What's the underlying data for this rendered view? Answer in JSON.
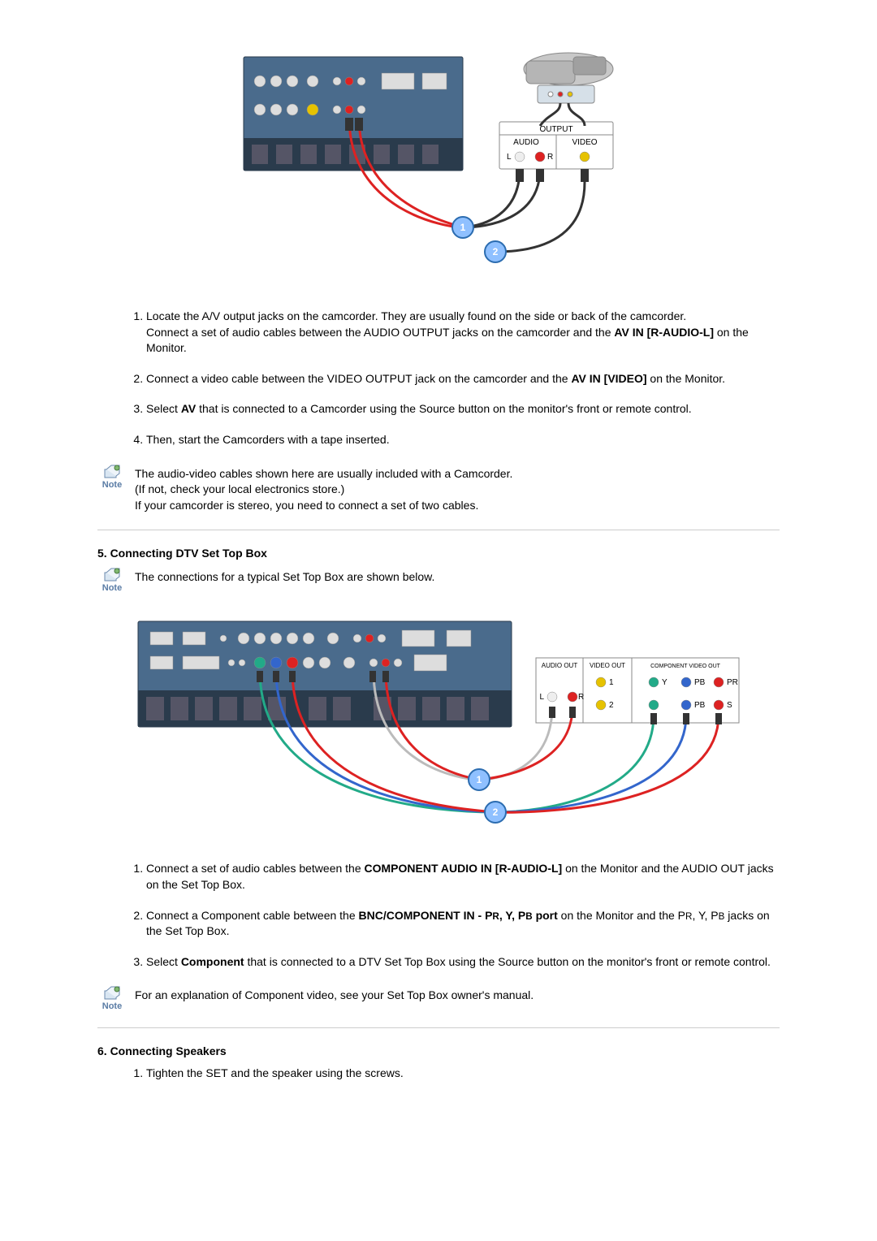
{
  "note_label": "Note",
  "section4": {
    "diagram": {
      "output_label": "OUTPUT",
      "audio_label": "AUDIO",
      "video_label": "VIDEO",
      "l_label": "L",
      "r_label": "R",
      "callout1": "1",
      "callout2": "2"
    },
    "steps": [
      {
        "p1_pre": "Locate the A/V output jacks on the camcorder. They are usually found on the side or back of the camcorder.",
        "p2_a": "Connect a set of audio cables between the AUDIO OUTPUT jacks on the camcorder and the ",
        "p2_bold": "AV IN [R-AUDIO-L]",
        "p2_b": " on the Monitor."
      },
      {
        "a": "Connect a video cable between the VIDEO OUTPUT jack on the camcorder and the ",
        "bold": "AV IN [VIDEO]",
        "b": " on the Monitor."
      },
      {
        "a": "Select ",
        "bold": "AV",
        "b": " that is connected to a Camcorder using the Source button on the monitor's front or remote control."
      },
      {
        "text": "Then, start the Camcorders with a tape inserted."
      }
    ],
    "note": {
      "line1": "The audio-video cables shown here are usually included with a Camcorder.",
      "line2": "(If not, check your local electronics store.)",
      "line3": "If your camcorder is stereo, you need to connect a set of two cables."
    }
  },
  "section5": {
    "heading": "5. Connecting DTV Set Top Box",
    "intro_note": "The connections for a typical Set Top Box are shown below.",
    "diagram": {
      "audio_out": "AUDIO OUT",
      "video_out": "VIDEO OUT",
      "component_out": "COMPONENT VIDEO OUT",
      "l": "L",
      "r": "R",
      "one": "1",
      "two": "2",
      "y": "Y",
      "pb": "PB",
      "pr": "PR",
      "s": "S",
      "callout1": "1",
      "callout2": "2"
    },
    "steps": [
      {
        "a": "Connect a set of audio cables between the ",
        "bold": "COMPONENT AUDIO IN [R-AUDIO-L]",
        "b": " on the Monitor and the AUDIO OUT jacks on the Set Top Box."
      },
      {
        "a": "Connect a Component cable between the ",
        "bold_a": "BNC/COMPONENT IN - P",
        "bold_r": "R",
        "bold_b": ", Y, P",
        "bold_b2": "B",
        "bold_c": " port",
        "b_a": " on the Monitor and the P",
        "b_r": "R",
        "b_b": ", Y, P",
        "b_b2": "B",
        "b_c": " jacks on the Set Top Box."
      },
      {
        "a": "Select ",
        "bold": "Component",
        "b": " that is connected to a DTV Set Top Box using the Source button on the monitor's front or remote control."
      }
    ],
    "note": "For an explanation of Component video, see your Set Top Box owner's manual."
  },
  "section6": {
    "heading": "6. Connecting Speakers",
    "steps": [
      {
        "text": "Tighten the SET and the speaker using the screws."
      }
    ]
  }
}
